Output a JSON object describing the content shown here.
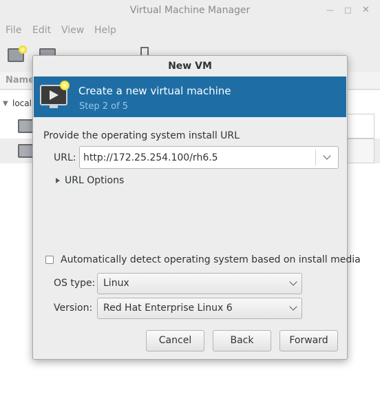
{
  "main_window": {
    "title": "Virtual Machine Manager",
    "menu": [
      "File",
      "Edit",
      "View",
      "Help"
    ],
    "list_header": "Name",
    "connection_label": "localho"
  },
  "dialog": {
    "title": "New VM",
    "banner": {
      "title": "Create a new virtual machine",
      "step": "Step 2 of 5"
    },
    "section_label": "Provide the operating system install URL",
    "url": {
      "label": "URL:",
      "value": "http://172.25.254.100/rh6.5"
    },
    "url_options_label": "URL Options",
    "auto_detect": {
      "label": "Automatically detect operating system based on install media",
      "checked": false
    },
    "os_type": {
      "label": "OS type:",
      "value": "Linux"
    },
    "version": {
      "label": "Version:",
      "value": "Red Hat Enterprise Linux 6"
    },
    "buttons": {
      "cancel": "Cancel",
      "back": "Back",
      "forward": "Forward"
    }
  },
  "colors": {
    "banner_bg": "#1e6ea5",
    "banner_step_text": "#9cc6e6",
    "window_bg": "#ededed"
  }
}
